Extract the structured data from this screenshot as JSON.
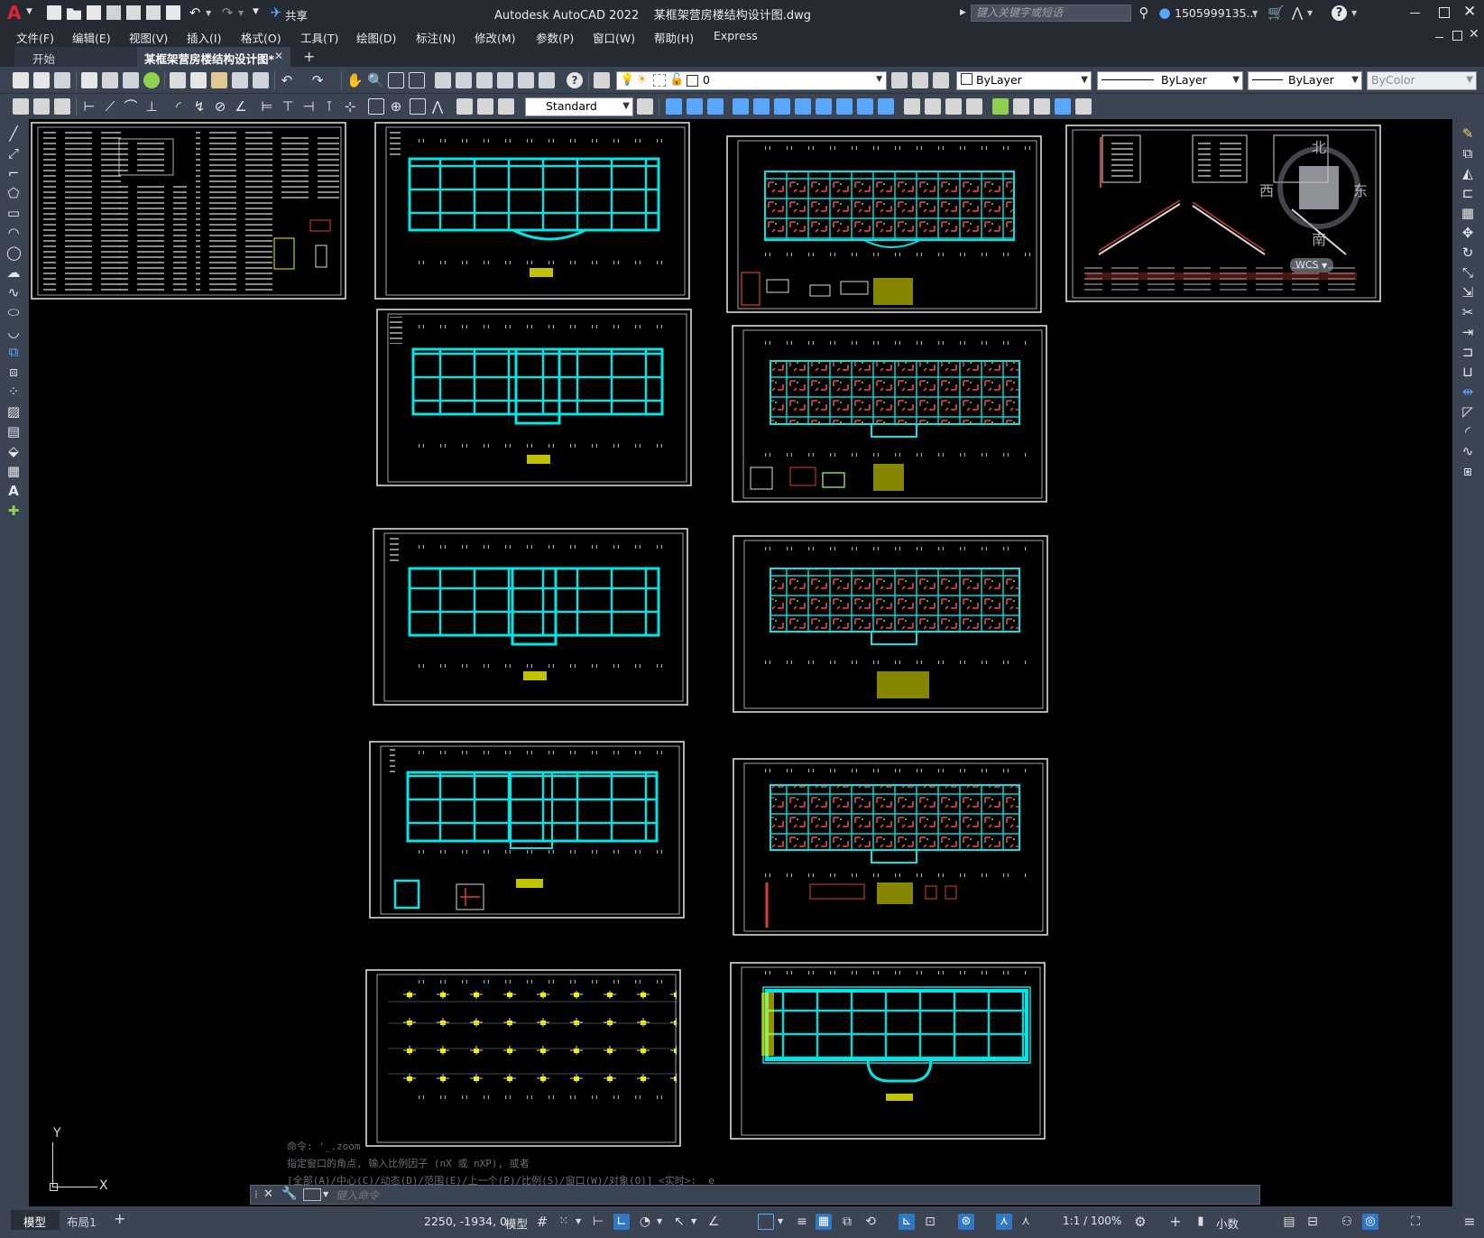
{
  "app": {
    "logo_letter": "A",
    "title": "Autodesk AutoCAD 2022    某框架营房楼结构设计图.dwg",
    "share_label": "共享",
    "search_placeholder": "键入关键字或短语",
    "user": "1505999135...",
    "accent_color": "#c8102e"
  },
  "menu": [
    "文件(F)",
    "编辑(E)",
    "视图(V)",
    "插入(I)",
    "格式(O)",
    "工具(T)",
    "绘图(D)",
    "标注(N)",
    "修改(M)",
    "参数(P)",
    "窗口(W)",
    "帮助(H)",
    "Express"
  ],
  "doc_tabs": [
    {
      "label": "开始",
      "active": false
    },
    {
      "label": "某框架营房楼结构设计图*",
      "active": true
    }
  ],
  "toolbar": {
    "layer_name": "0",
    "color": "ByLayer",
    "linetype": "ByLayer",
    "lineweight": "ByLayer",
    "plotstyle": "ByColor",
    "text_style": "Standard"
  },
  "viewcube": {
    "north": "北",
    "south": "南",
    "east": "东",
    "west": "西",
    "wcs": "WCS"
  },
  "ucs": {
    "x_label": "X",
    "y_label": "Y"
  },
  "command": {
    "history": [
      "命令: '_.zoom",
      "指定窗口的角点, 输入比例因子 (nX 或 nXP), 或者",
      "[全部(A)/中心(C)/动态(D)/范围(E)/上一个(P)/比例(S)/窗口(W)/对象(O)] <实时>: _e"
    ],
    "placeholder": "键入命令"
  },
  "layout_tabs": [
    {
      "label": "模型",
      "active": true
    },
    {
      "label": "布局1",
      "active": false
    }
  ],
  "status": {
    "coords": "2250, -1934, 0",
    "model_label": "模型",
    "scale": "1:1 / 100%",
    "units": "小数"
  },
  "colors": {
    "structure": "#00e5e5",
    "rebar": "#d83c3c",
    "annotation": "#f2f200",
    "sheet_border": "#d9d9d9"
  }
}
